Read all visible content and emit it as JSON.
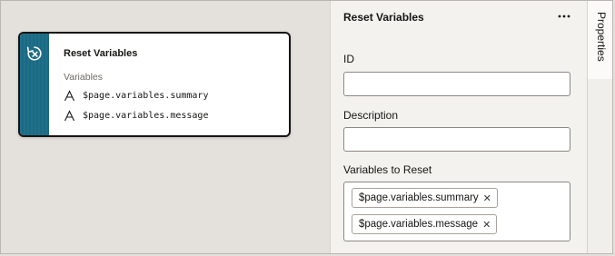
{
  "canvas": {
    "card": {
      "title": "Reset Variables",
      "icon": "reset-variables-icon",
      "section_label": "Variables",
      "variables": [
        {
          "type_icon": "string-type-icon",
          "name": "$page.variables.summary"
        },
        {
          "type_icon": "string-type-icon",
          "name": "$page.variables.message"
        }
      ],
      "accent_color": "#1f6f8b"
    }
  },
  "properties": {
    "title": "Reset Variables",
    "more_icon": "more-options-icon",
    "id_label": "ID",
    "id_value": "",
    "description_label": "Description",
    "description_value": "",
    "variables_label": "Variables to Reset",
    "chips": [
      {
        "label": "$page.variables.summary",
        "remove_icon": "close-icon"
      },
      {
        "label": "$page.variables.message",
        "remove_icon": "close-icon"
      }
    ],
    "remove_glyph": "✕"
  },
  "side_tabs": [
    {
      "label": "Properties"
    }
  ]
}
